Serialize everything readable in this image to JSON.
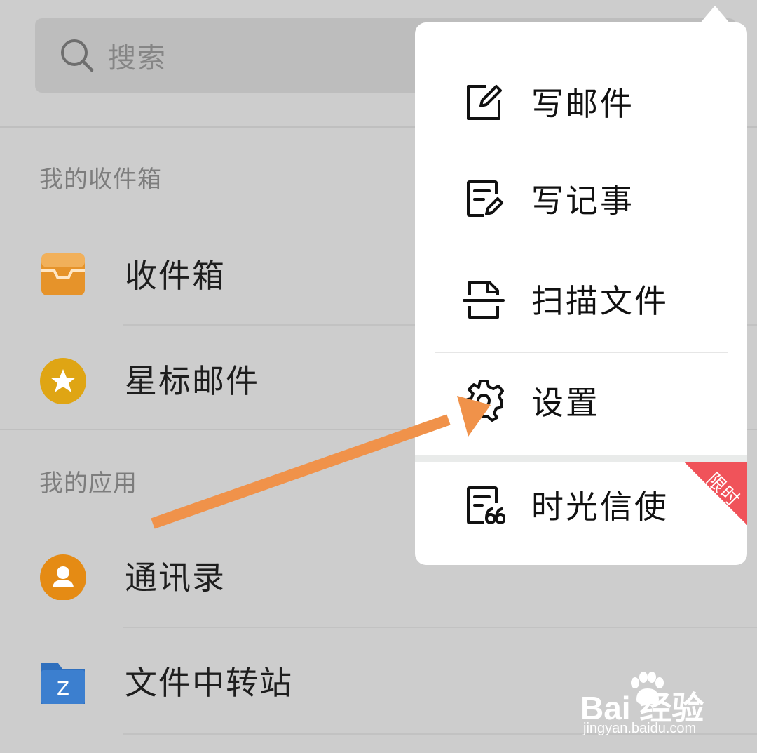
{
  "search": {
    "placeholder": "搜索"
  },
  "sections": {
    "mailboxes_title": "我的收件箱",
    "apps_title": "我的应用"
  },
  "mailboxes": [
    {
      "label": "收件箱",
      "icon": "inbox-tray-icon",
      "color": "#e6932a"
    },
    {
      "label": "星标邮件",
      "icon": "star-icon",
      "color": "#dfa514"
    }
  ],
  "apps": [
    {
      "label": "通讯录",
      "icon": "contact-person-icon",
      "color": "#e58b14"
    },
    {
      "label": "文件中转站",
      "icon": "folder-z-icon",
      "color": "#3c7fcf"
    }
  ],
  "popup_menu": {
    "items": [
      {
        "label": "写邮件",
        "icon": "compose-icon"
      },
      {
        "label": "写记事",
        "icon": "note-icon"
      },
      {
        "label": "扫描文件",
        "icon": "scan-document-icon"
      },
      {
        "label": "设置",
        "icon": "gear-icon"
      },
      {
        "label": "时光信使",
        "icon": "time-letter-icon"
      }
    ],
    "badge": {
      "text": "限时",
      "color": "#f0535a"
    }
  },
  "annotation": {
    "arrow_color": "#f0924a"
  },
  "watermark": {
    "logo": "Bai  经验",
    "url": "jingyan.baidu.com"
  }
}
